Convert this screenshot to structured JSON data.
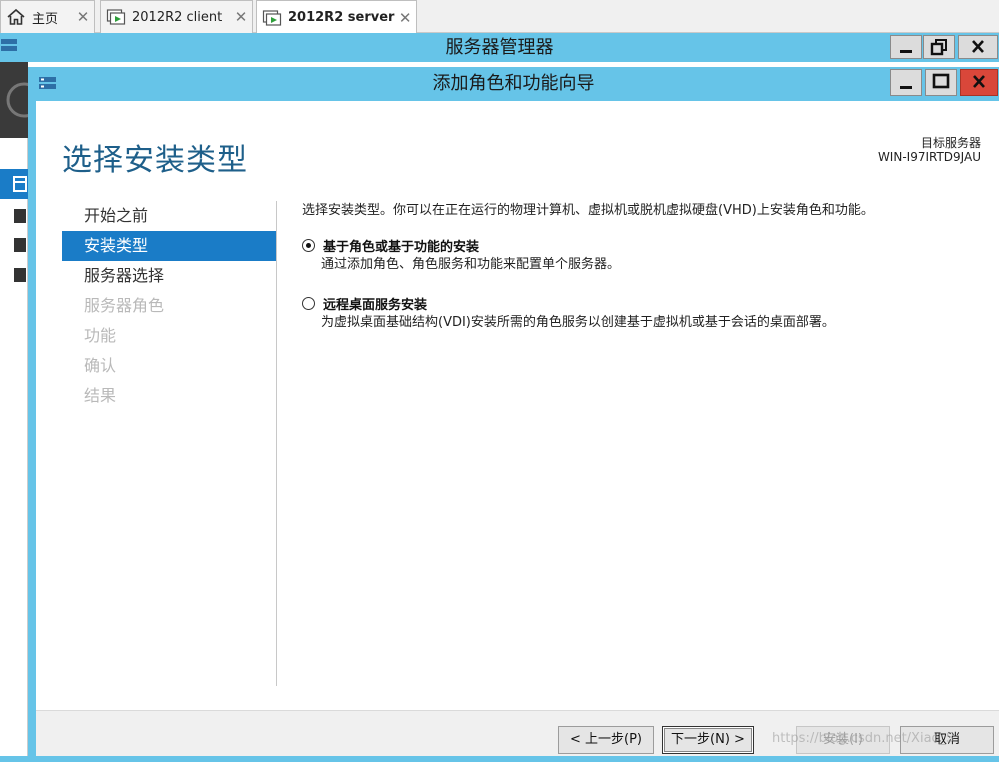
{
  "tabs": [
    {
      "label": "主页",
      "icon": "home-icon",
      "active": false
    },
    {
      "label": "2012R2 client",
      "icon": "vm-icon",
      "active": false
    },
    {
      "label": "2012R2 server",
      "icon": "vm-icon",
      "active": true
    }
  ],
  "tab_close_glyph": "✕",
  "server_manager": {
    "title": "服务器管理器"
  },
  "wizard": {
    "title": "添加角色和功能向导",
    "page_title": "选择安装类型",
    "target_label": "目标服务器",
    "target_name": "WIN-I97IRTD9JAU",
    "nav_items": [
      {
        "label": "开始之前",
        "state": "normal"
      },
      {
        "label": "安装类型",
        "state": "active"
      },
      {
        "label": "服务器选择",
        "state": "normal"
      },
      {
        "label": "服务器角色",
        "state": "disabled"
      },
      {
        "label": "功能",
        "state": "disabled"
      },
      {
        "label": "确认",
        "state": "disabled"
      },
      {
        "label": "结果",
        "state": "disabled"
      }
    ],
    "intro": "选择安装类型。你可以在正在运行的物理计算机、虚拟机或脱机虚拟硬盘(VHD)上安装角色和功能。",
    "options": [
      {
        "label": "基于角色或基于功能的安装",
        "description": "通过添加角色、角色服务和功能来配置单个服务器。",
        "selected": true
      },
      {
        "label": "远程桌面服务安装",
        "description": "为虚拟桌面基础结构(VDI)安装所需的角色服务以创建基于虚拟机或基于会话的桌面部署。",
        "selected": false
      }
    ],
    "buttons": {
      "previous": "< 上一步(P)",
      "next": "下一步(N) >",
      "install": "安装(I)",
      "cancel": "取消"
    }
  },
  "watermark": "https://blog.csdn.net/Xiao_S",
  "colors": {
    "titlebar": "#66c4e8",
    "accent": "#1a7cc7",
    "page_title": "#1e5f8a",
    "close_button": "#d9473a"
  }
}
